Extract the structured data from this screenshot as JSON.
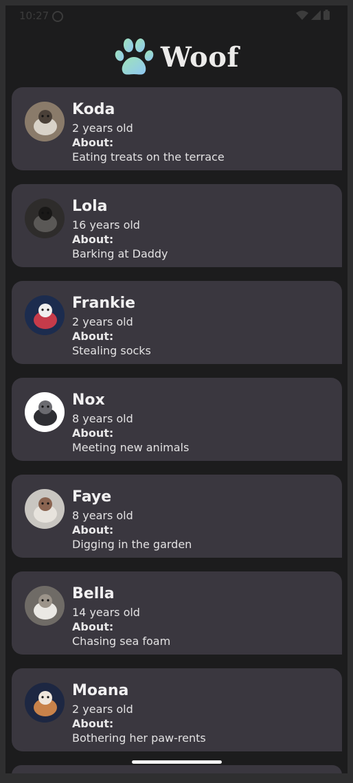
{
  "status": {
    "time": "10:27"
  },
  "app": {
    "title": "Woof"
  },
  "about_label": "About:",
  "dogs": [
    {
      "name": "Koda",
      "age": "2 years old",
      "hobby": "Eating treats on the terrace",
      "avatar_colors": [
        "#8a7b6a",
        "#d8d2c8",
        "#4a4038"
      ]
    },
    {
      "name": "Lola",
      "age": "16 years old",
      "hobby": "Barking at Daddy",
      "avatar_colors": [
        "#2e2c2b",
        "#5a5856",
        "#191817"
      ]
    },
    {
      "name": "Frankie",
      "age": "2 years old",
      "hobby": "Stealing socks",
      "avatar_colors": [
        "#1c2c4e",
        "#c63b4a",
        "#f0efee"
      ]
    },
    {
      "name": "Nox",
      "age": "8 years old",
      "hobby": "Meeting new animals",
      "avatar_colors": [
        "#ffffff",
        "#2e2e33",
        "#6b6b70"
      ]
    },
    {
      "name": "Faye",
      "age": "8 years old",
      "hobby": "Digging in the garden",
      "avatar_colors": [
        "#c9c6c1",
        "#e7e3dd",
        "#8a6451"
      ]
    },
    {
      "name": "Bella",
      "age": "14 years old",
      "hobby": "Chasing sea foam",
      "avatar_colors": [
        "#6f6b66",
        "#eae8e4",
        "#9c948a"
      ]
    },
    {
      "name": "Moana",
      "age": "2 years old",
      "hobby": "Bothering her paw-rents",
      "avatar_colors": [
        "#1d2742",
        "#c8824a",
        "#efe6dc"
      ]
    }
  ]
}
